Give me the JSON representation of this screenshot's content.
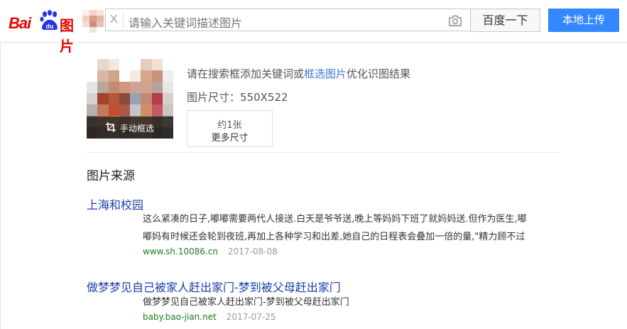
{
  "header": {
    "logo_text_bai": "Bai",
    "logo_text_du": "du",
    "logo_text_tu": "图片",
    "clear_label": "X",
    "search_placeholder": "请输入关键词描述图片",
    "search_button": "百度一下",
    "upload_button": "本地上传",
    "camera_icon": "camera-icon"
  },
  "preview": {
    "crop_label": "手动框选",
    "crop_icon": "crop-icon"
  },
  "info": {
    "hint_before": "请在搜索框添加关键词或",
    "hint_link": "框选图片",
    "hint_after": "优化识图结果",
    "size_label": "图片尺寸：",
    "size_value": "550X522",
    "count": "约1张",
    "more_sizes": "更多尺寸"
  },
  "sources": {
    "title": "图片来源",
    "results": [
      {
        "title": "上海和校园",
        "desc_line1": "这么紧凑的日子,嘟嘟需要两代人接送.白天是爷爷送,晚上等妈妈下班了就妈妈送.但作为医生,嘟",
        "desc_line2": "嘟妈有时候还会轮到夜班,再加上各种学习和出差,她自己的日程表会叠加一倍的量,\"精力顾不过",
        "url": "www.sh.10086.cn",
        "date": "2017-08-08"
      },
      {
        "title": "做梦梦见自己被家人赶出家门-梦到被父母赶出家门",
        "desc_line1": "做梦梦见自己被家人赶出家门-梦到被父母赶出家门",
        "url": "baby.bao-jian.net",
        "date": "2017-07-25"
      }
    ]
  },
  "colors": {
    "brand_red": "#e10601",
    "brand_blue": "#2932e1",
    "upload_blue": "#3388ff",
    "link_blue": "#1a3ea8",
    "url_green": "#207a1f"
  }
}
